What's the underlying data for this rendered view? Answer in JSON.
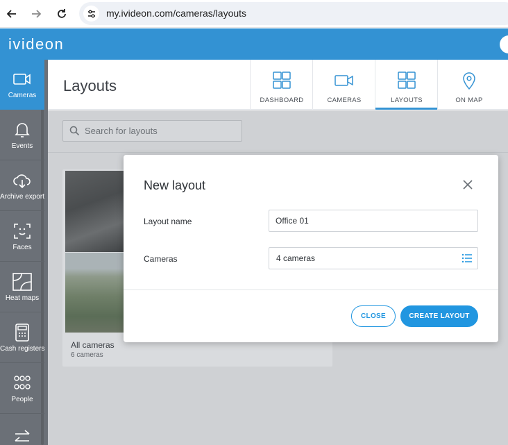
{
  "browser": {
    "url": "my.ivideon.com/cameras/layouts"
  },
  "header": {
    "logo": "ivideon"
  },
  "colors": {
    "brand": "#3392d3",
    "sidebar": "#6b7077",
    "button_primary": "#2196e0"
  },
  "sidebar": {
    "items": [
      {
        "label": "Cameras",
        "icon": "camera-icon"
      },
      {
        "label": "Events",
        "icon": "bell-icon"
      },
      {
        "label": "Archive export",
        "icon": "cloud-download-icon"
      },
      {
        "label": "Faces",
        "icon": "face-scan-icon"
      },
      {
        "label": "Heat maps",
        "icon": "heat-map-icon"
      },
      {
        "label": "Cash registers",
        "icon": "cash-register-icon"
      },
      {
        "label": "People",
        "icon": "people-icon"
      }
    ]
  },
  "page": {
    "title": "Layouts"
  },
  "view_tabs": [
    {
      "label": "DASHBOARD",
      "icon": "grid-icon"
    },
    {
      "label": "CAMERAS",
      "icon": "camera-icon"
    },
    {
      "label": "LAYOUTS",
      "icon": "grid-icon"
    },
    {
      "label": "ON MAP",
      "icon": "map-pin-icon"
    }
  ],
  "search": {
    "placeholder": "Search for layouts"
  },
  "layout_card": {
    "title": "All cameras",
    "subtitle": "6 cameras"
  },
  "modal": {
    "title": "New layout",
    "layout_name_label": "Layout name",
    "layout_name_value": "Office 01",
    "cameras_label": "Cameras",
    "cameras_value": "4 cameras",
    "close_button": "CLOSE",
    "create_button": "CREATE LAYOUT"
  }
}
